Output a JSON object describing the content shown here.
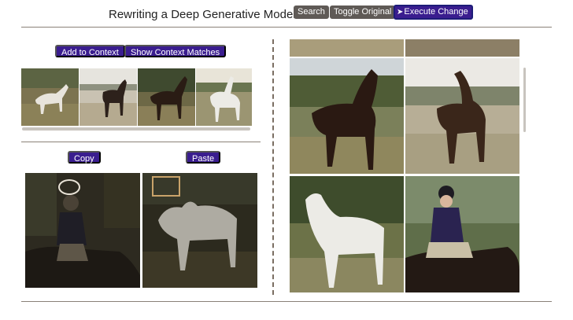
{
  "header": {
    "title": "Rewriting a Deep Generative Model",
    "buttons": {
      "search": "Search",
      "toggle_original": "Toggle Original",
      "execute_change": "Execute Change"
    }
  },
  "context_panel": {
    "add_to_context": "Add to Context",
    "show_context_matches": "Show Context Matches",
    "thumbnails": [
      {
        "icon": "horse-photo"
      },
      {
        "icon": "horse-photo"
      },
      {
        "icon": "horse-photo"
      },
      {
        "icon": "horse-photo"
      }
    ]
  },
  "edit_panel": {
    "copy": "Copy",
    "paste": "Paste",
    "source_image": {
      "icon": "rider-on-horse-photo"
    },
    "target_image": {
      "icon": "white-horse-photo"
    }
  },
  "results_panel": {
    "images": [
      {
        "icon": "horse-photo"
      },
      {
        "icon": "horse-photo"
      },
      {
        "icon": "dark-horse-photo"
      },
      {
        "icon": "brown-horse-photo"
      },
      {
        "icon": "white-horse-photo"
      },
      {
        "icon": "rider-on-horse-photo"
      }
    ]
  },
  "colors": {
    "accent": "#3a1d8f",
    "gray_button": "#5f5a56",
    "divider": "#8a8178"
  }
}
